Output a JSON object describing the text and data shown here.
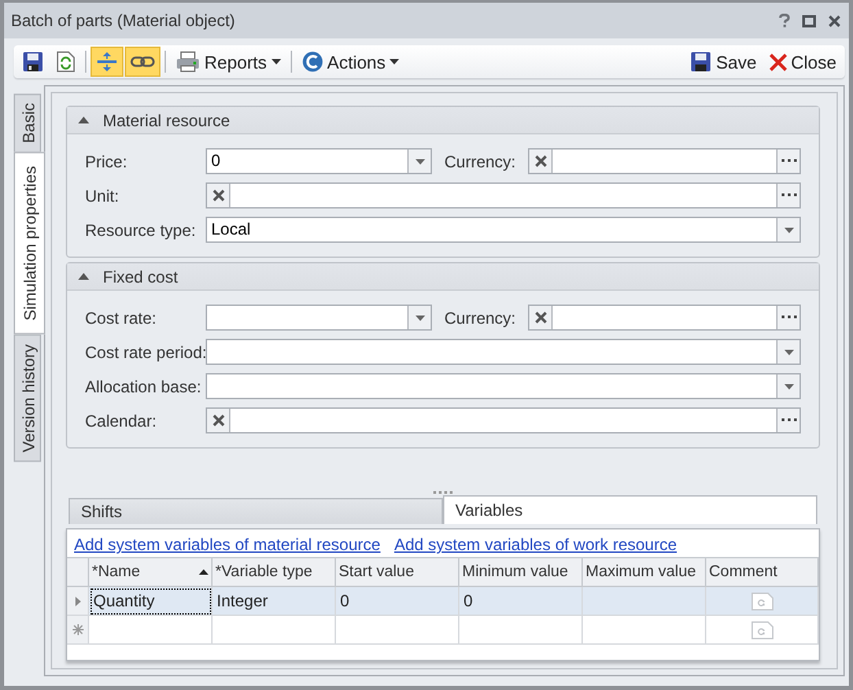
{
  "window": {
    "title": "Batch of parts (Material object)"
  },
  "toolbar": {
    "toggles": [
      {
        "on": true
      },
      {
        "on": true
      }
    ],
    "menus": [
      {
        "label": "Reports"
      },
      {
        "label": "Actions"
      }
    ],
    "save": "Save",
    "close": "Close"
  },
  "side_tabs": [
    {
      "label": "Basic",
      "selected": false
    },
    {
      "label": "Simulation properties",
      "selected": true
    },
    {
      "label": "Version history",
      "selected": false
    }
  ],
  "groups": [
    {
      "title": "Material resource",
      "expanded": true,
      "rows": [
        {
          "fields": [
            {
              "label": "Price:",
              "kind": "dropdown",
              "value": "0"
            },
            {
              "label": "Currency:",
              "kind": "lookup"
            }
          ]
        },
        {
          "fields": [
            {
              "label": "Unit:",
              "kind": "lookup"
            }
          ]
        },
        {
          "fields": [
            {
              "label": "Resource type:",
              "kind": "dropdown",
              "value": "Local"
            }
          ]
        }
      ]
    },
    {
      "title": "Fixed cost",
      "expanded": true,
      "rows": [
        {
          "fields": [
            {
              "label": "Cost rate:",
              "kind": "dropdown"
            },
            {
              "label": "Currency:",
              "kind": "lookup"
            }
          ]
        },
        {
          "fields": [
            {
              "label": "Cost rate period:",
              "kind": "dropdown"
            }
          ]
        },
        {
          "fields": [
            {
              "label": "Allocation base:",
              "kind": "dropdown"
            }
          ]
        },
        {
          "fields": [
            {
              "label": "Calendar:",
              "kind": "lookup"
            }
          ]
        }
      ]
    }
  ],
  "bottom_tabs": [
    {
      "label": "Shifts",
      "selected": false
    },
    {
      "label": "Variables",
      "selected": true
    }
  ],
  "links": [
    "Add system variables of material resource",
    "Add system variables of work resource"
  ],
  "grid": {
    "columns": [
      {
        "label": "*Name",
        "sorted": true,
        "kind": "text"
      },
      {
        "label": "*Variable type",
        "sorted": false,
        "kind": "text"
      },
      {
        "label": "Start value",
        "sorted": false,
        "kind": "text"
      },
      {
        "label": "Minimum value",
        "sorted": false,
        "kind": "text"
      },
      {
        "label": "Maximum value",
        "sorted": false,
        "kind": "text"
      },
      {
        "label": "Comment",
        "sorted": false,
        "kind": "comment"
      }
    ],
    "rows": [
      {
        "kind": "current",
        "selected": true,
        "cells": [
          {
            "text": "Quantity",
            "focused": true
          },
          {
            "text": "Integer",
            "focused": false
          },
          {
            "text": "0",
            "focused": false
          },
          {
            "text": "0",
            "focused": false
          },
          {
            "focused": false
          },
          {
            "focused": false
          }
        ]
      },
      {
        "kind": "new",
        "selected": false
      }
    ]
  }
}
